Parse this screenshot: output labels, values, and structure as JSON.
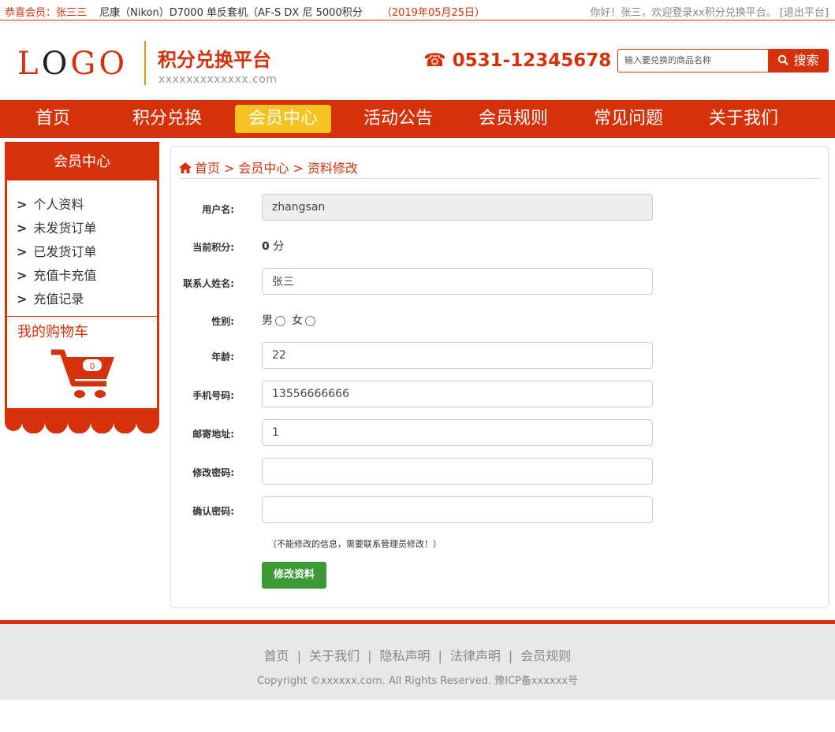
{
  "topbar": {
    "congrats": "恭喜会员：张三三",
    "product": "尼康（Nikon）D7000 单反套机（AF-S DX 尼",
    "points": "5000积分",
    "date": "（2019年05月25日）",
    "welcome": "你好！张三，欢迎登录xx积分兑换平台。",
    "logout": "[退出平台]"
  },
  "header": {
    "logo_l": "L",
    "logo_o": "O",
    "logo_go": "GO",
    "brand": "积分兑换平台",
    "brand_sub": "xxxxxxxxxxxxx.com",
    "phone": "☎ 0531-12345678",
    "search_placeholder": "输入要兑换的商品名称",
    "search_label": "搜索"
  },
  "nav": {
    "items": [
      "首页",
      "积分兑换",
      "会员中心",
      "活动公告",
      "会员规则",
      "常见问题",
      "关于我们"
    ],
    "active": "会员中心"
  },
  "sidebar": {
    "title": "会员中心",
    "items": [
      "个人资料",
      "未发货订单",
      "已发货订单",
      "充值卡充值",
      "充值记录"
    ],
    "cart_title": "我的购物车",
    "cart_count": "0"
  },
  "breadcrumb": {
    "home": "首页",
    "section": "会员中心",
    "page": "资料修改",
    "separator": ">"
  },
  "form": {
    "username_label": "用户名:",
    "username_value": "zhangsan",
    "points_label": "当前积分:",
    "points_value": "0",
    "points_unit": "分",
    "name_label": "联系人姓名:",
    "name_value": "张三",
    "gender_label": "性别:",
    "gender_male": "男",
    "gender_female": "女",
    "age_label": "年龄:",
    "age_value": "22",
    "phone_label": "手机号码:",
    "phone_value": "13556666666",
    "address_label": "邮寄地址:",
    "address_value": "1",
    "password_label": "修改密码:",
    "password_value": "",
    "confirm_label": "确认密码:",
    "confirm_value": "",
    "note": "（不能修改的信息，需要联系管理员修改！）",
    "submit_label": "修改资料"
  },
  "footer": {
    "links": [
      "首页",
      "关于我们",
      "隐私声明",
      "法律声明",
      "会员规则"
    ],
    "separator": "|",
    "copyright": "Copyright ©xxxxxx.com. All Rights Reserved. 豫ICP备xxxxxx号"
  },
  "colors": {
    "primary": "#d7310b",
    "nav_active": "#f7c322",
    "submit": "#3c9b35",
    "divider_accent": "#f29400"
  }
}
